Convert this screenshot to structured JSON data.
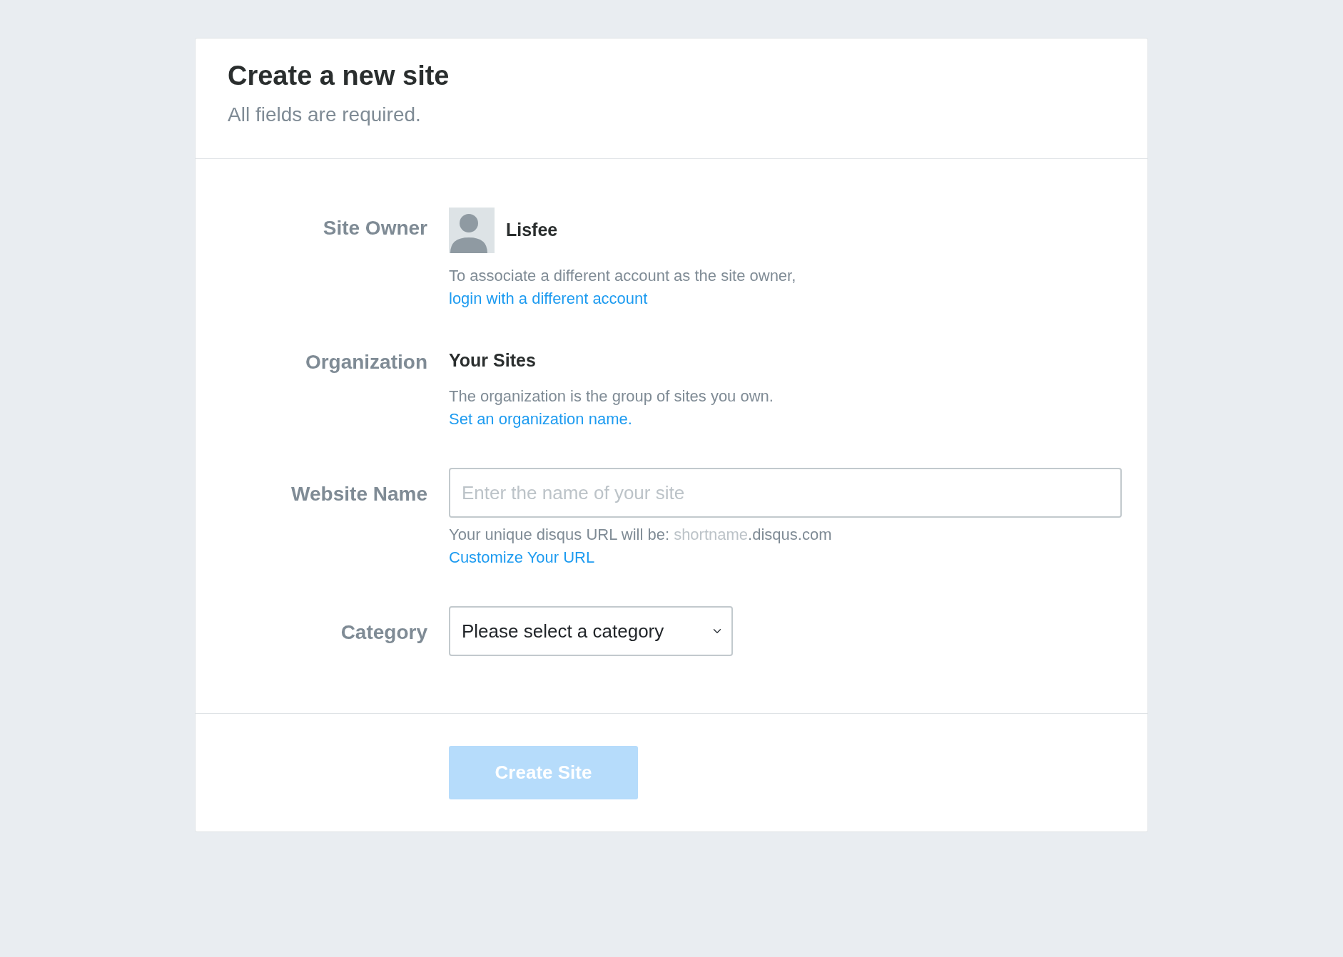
{
  "header": {
    "title": "Create a new site",
    "subtitle": "All fields are required."
  },
  "site_owner": {
    "label": "Site Owner",
    "name": "Lisfee",
    "help": "To associate a different account as the site owner,",
    "link": "login with a different account"
  },
  "organization": {
    "label": "Organization",
    "value": "Your Sites",
    "help": "The organization is the group of sites you own.",
    "link": "Set an organization name."
  },
  "website_name": {
    "label": "Website Name",
    "placeholder": "Enter the name of your site",
    "help_prefix": "Your unique disqus URL will be: ",
    "help_shortname": "shortname",
    "help_suffix": ".disqus.com",
    "link": "Customize Your URL"
  },
  "category": {
    "label": "Category",
    "value": "Please select a category"
  },
  "submit": {
    "label": "Create Site",
    "disabled": true
  }
}
